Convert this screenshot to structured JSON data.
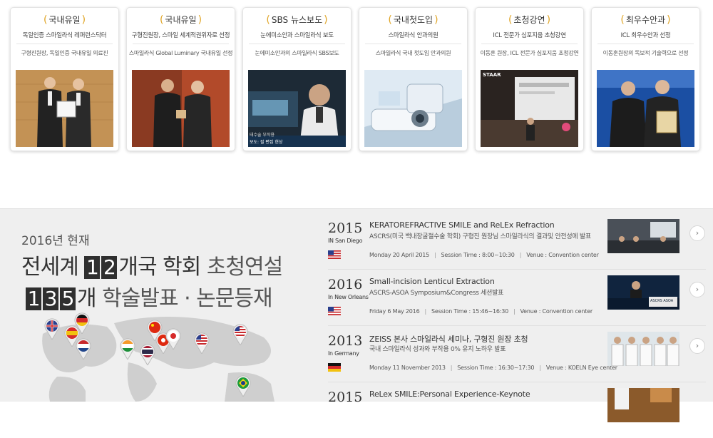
{
  "cards": [
    {
      "title": "국내유일",
      "subtitle": "독일인증 스마일라식 레퍼런스닥터",
      "desc": "구형진원장, 독일인증 국내유일 의료진"
    },
    {
      "title": "국내유일",
      "subtitle": "구형진원장, 스마일 세계적권위자로 선정",
      "desc": "스마일라식 Global Luminary 국내유일 선정"
    },
    {
      "title": "SBS 뉴스보도",
      "subtitle": "눈에미소안과 스마일라식 보도",
      "desc": "눈에미소안과의 스마일라식 SBS보도",
      "photo_caption": "태수술 부작용",
      "photo_caption2": "보도: 될 편집 현상"
    },
    {
      "title": "국내첫도입",
      "subtitle": "스마일라식 안과의원",
      "desc": "스마일라식 국내 첫도입 안과의원"
    },
    {
      "title": "초청강연",
      "subtitle": "ICL 전문가 심포지움 초청강연",
      "desc": "이동훈 원장, ICL 전문가 심포지움 초청강연",
      "photo_caption": "STAAR"
    },
    {
      "title": "최우수안과",
      "subtitle": "ICL 최우수안과 선정",
      "desc": "이동훈원장의 독보적 기술력으로 선정"
    }
  ],
  "stats": {
    "as_of": "2016년 현재",
    "line1_prefix": "전세계",
    "line1_digits": [
      "1",
      "2"
    ],
    "line1_suffix_a": "개국 학회",
    "line1_suffix_b": "초청연설",
    "line2_digits": [
      "1",
      "3",
      "5"
    ],
    "line2_suffix_a": "개",
    "line2_suffix_b": "학술발표 · 논문등재"
  },
  "events": [
    {
      "year": "2015",
      "location": "IN San Diego",
      "flag": "us",
      "title": "KERATOREFRACTIVE SMILE and ReLEx Refraction",
      "desc": "ASCRS(미국 백내장굴절수술 학회) 구형진 원장님 스마일라식의 결과및 안전성에 발표",
      "date": "Monday 20 April 2015",
      "session": "Session Time : 8:00~10:30",
      "venue": "Venue : Convention center"
    },
    {
      "year": "2016",
      "location": "In New Orleans",
      "flag": "us",
      "title": "Small-incision Lenticul Extraction",
      "desc": "ASCRS-ASOA Symposium&Congress 세션발표",
      "date": "Friday 6 May 2016",
      "session": "Session Time : 15:46~16:30",
      "venue": "Venue : Convention center",
      "thumb_caption": "ASCRS ASOA"
    },
    {
      "year": "2013",
      "location": "In Germany",
      "flag": "de",
      "title": "ZEISS 본사 스마일라식 세미나, 구형진 원장 초청",
      "desc": "국내 스마일라식 성과와 부작용 0% 유지 노하우 발표",
      "date": "Monday 11 November 2013",
      "session": "Session Time : 16:30~17:30",
      "venue": "Venue : KOELN Eye center"
    },
    {
      "year": "2015",
      "location": "",
      "flag": "",
      "title": "ReLex SMILE:Personal Experience-Keynote",
      "desc": "",
      "date": "",
      "session": "",
      "venue": ""
    }
  ],
  "arrow_glyph": "›",
  "colors": {
    "laurel": "#e0a526",
    "digit_bg": "#2f2f2f",
    "section_bg": "#efefef"
  }
}
